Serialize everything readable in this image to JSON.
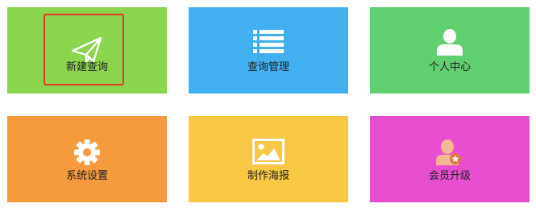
{
  "tiles": [
    {
      "label": "新建查询",
      "icon": "paper-plane-icon",
      "color": "#8bd44e",
      "text_color": "#222222",
      "highlighted": true
    },
    {
      "label": "查询管理",
      "icon": "list-icon",
      "color": "#42aff0",
      "text_color": "#222222"
    },
    {
      "label": "个人中心",
      "icon": "user-icon",
      "color": "#5fcf6f",
      "text_color": "#222222"
    },
    {
      "label": "系统设置",
      "icon": "gear-icon",
      "color": "#f59a3d",
      "text_color": "#222222"
    },
    {
      "label": "制作海报",
      "icon": "image-icon",
      "color": "#f8c845",
      "text_color": "#222222"
    },
    {
      "label": "会员升级",
      "icon": "member-upgrade-icon",
      "color": "#e84fd0",
      "text_color": "#222222"
    }
  ],
  "highlight_color": "#e03a26"
}
